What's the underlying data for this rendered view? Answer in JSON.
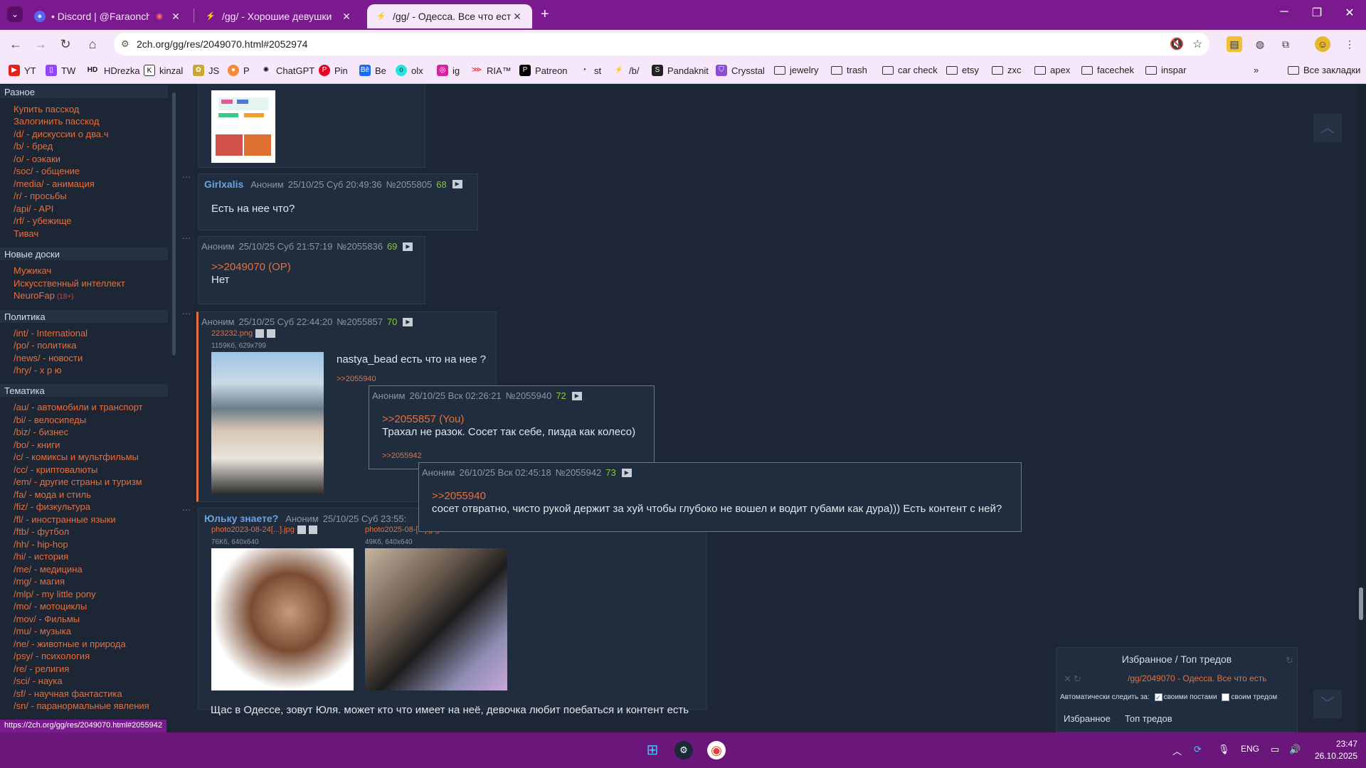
{
  "browser": {
    "tabs": [
      {
        "title": "• Discord | @Faraonchik",
        "icon": "discord-icon",
        "active": false
      },
      {
        "title": "/gg/ - Хорошие девушки",
        "icon": "2ch-icon",
        "active": false
      },
      {
        "title": "/gg/ - Одесса. Все что есть",
        "icon": "2ch-icon",
        "active": true
      }
    ],
    "url": "2ch.org/gg/res/2049070.html#2052974",
    "bookmarks": [
      "YT",
      "TW",
      "HDrezka",
      "kinzal",
      "JS",
      "P",
      "ChatGPT",
      "Pin",
      "Be",
      "olx",
      "ig",
      "RIA™",
      "Patreon",
      "st",
      "/b/",
      "Pandaknit",
      "Crysstal",
      "jewelry",
      "trash",
      "car check",
      "etsy",
      "zxc",
      "apex",
      "facechek",
      "inspar"
    ],
    "all_bookmarks": "Все закладки",
    "status_url": "https://2ch.org/gg/res/2049070.html#2055942"
  },
  "sidebar": {
    "section_misc": "Разное",
    "misc_links": [
      "Купить пасскод",
      "Залогинить пасскод",
      "/d/ - дискуссии о два.ч",
      "/b/ - бред",
      "/o/ - оэкаки",
      "/soc/ - общение",
      "/media/ - анимация",
      "/r/ - просьбы",
      "/api/ - API",
      "/rf/ - убежище",
      "Тивач"
    ],
    "section_new": "Новые доски",
    "new_links": [
      "Мужикач",
      "Искусственный интеллект",
      "NeuroFap"
    ],
    "neurofap_tag": "(18+)",
    "section_politics": "Политика",
    "politics_links": [
      "/int/ - International",
      "/po/ - политика",
      "/news/ - новости",
      "/hry/ - х р ю"
    ],
    "section_theme": "Тематика",
    "theme_links": [
      "/au/ - автомобили и транспорт",
      "/bi/ - велосипеды",
      "/biz/ - бизнес",
      "/bo/ - книги",
      "/c/ - комиксы и мультфильмы",
      "/cc/ - криптовалюты",
      "/em/ - другие страны и туризм",
      "/fa/ - мода и стиль",
      "/fiz/ - физкультура",
      "/fl/ - иностранные языки",
      "/ftb/ - футбол",
      "/hh/ - hip-hop",
      "/hi/ - история",
      "/me/ - медицина",
      "/mg/ - магия",
      "/mlp/ - my little pony",
      "/mo/ - мотоциклы",
      "/mov/ - Фильмы",
      "/mu/ - музыка",
      "/ne/ - животные и природа",
      "/psy/ - психология",
      "/re/ - религия",
      "/sci/ - наука",
      "/sf/ - научная фантастика",
      "/sn/ - паранормальные явления"
    ]
  },
  "posts": {
    "p68": {
      "name": "Girlxalis",
      "anon": "Аноним",
      "date": "25/10/25 Суб 20:49:36",
      "num": "№2055805",
      "count": "68",
      "text": "Есть на нее что?"
    },
    "p69": {
      "anon": "Аноним",
      "date": "25/10/25 Суб 21:57:19",
      "num": "№2055836",
      "count": "69",
      "quote": ">>2049070 (OP)",
      "text": "Нет"
    },
    "p70": {
      "anon": "Аноним",
      "date": "25/10/25 Суб 22:44:20",
      "num": "№2055857",
      "count": "70",
      "file": "223232.png",
      "meta": "1159Кб, 629x799",
      "text": "nastya_bead есть что на нее ?",
      "reply": ">>2055940"
    },
    "p71": {
      "name": "Юльку знаете?",
      "anon": "Аноним",
      "date": "25/10/25 Суб 23:55:",
      "file1": "photo2023-08-24[...].jpg",
      "meta1": "76Кб, 640x640",
      "file2": "photo2025-08-[...].jpg",
      "meta2": "49Кб, 640x640",
      "text": "Щас в Одессе, зовут Юля. может кто что имеет на неё, девочка любит поебаться и контент есть"
    },
    "pop72": {
      "anon": "Аноним",
      "date": "26/10/25 Вск 02:26:21",
      "num": "№2055940",
      "count": "72",
      "quote": ">>2055857 (You)",
      "text": "Трахал не разок. Сосет так себе, пизда как колесо)",
      "reply": ">>2055942"
    },
    "pop73": {
      "anon": "Аноним",
      "date": "26/10/25 Вск 02:45:18",
      "num": "№2055942",
      "count": "73",
      "quote": ">>2055940",
      "text": "сосет отвратно, чисто рукой держит за хуй чтобы глубоко не вошел и водит губами как дура))) Есть контент с ней?"
    }
  },
  "favorites": {
    "title": "Избранное / Топ тредов",
    "thread": "/gg/2049070 - Одесса. Все что есть",
    "auto_label": "Автоматически следить за:",
    "own_posts": "своими постами",
    "own_thread": "своим тредом",
    "btn_fav": "Избранное",
    "btn_top": "Топ тредов"
  },
  "taskbar": {
    "lang": "ENG",
    "time": "23:47",
    "date": "26.10.2025"
  }
}
